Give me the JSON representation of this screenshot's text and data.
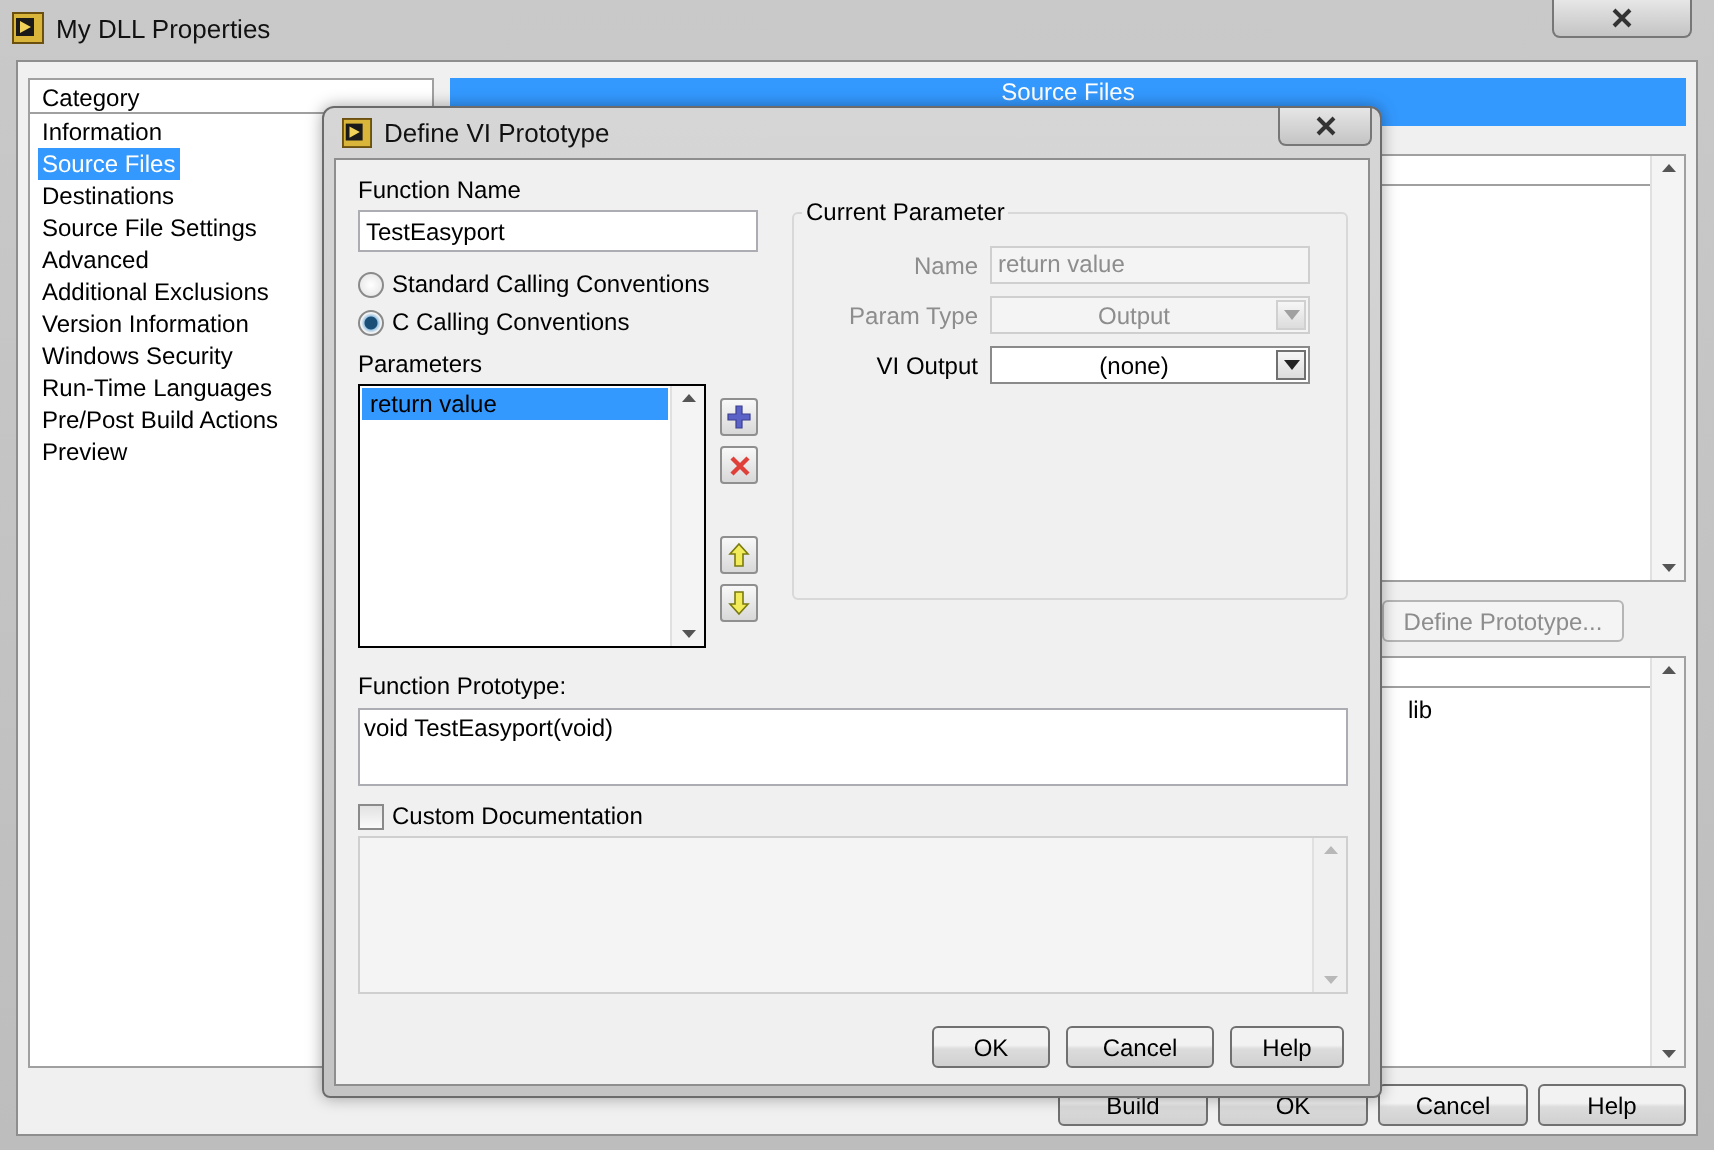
{
  "window": {
    "title": "My DLL Properties"
  },
  "category": {
    "header": "Category",
    "items": [
      {
        "label": "Information",
        "selected": false
      },
      {
        "label": "Source Files",
        "selected": true
      },
      {
        "label": "Destinations",
        "selected": false
      },
      {
        "label": "Source File Settings",
        "selected": false
      },
      {
        "label": "Advanced",
        "selected": false
      },
      {
        "label": "Additional Exclusions",
        "selected": false
      },
      {
        "label": "Version Information",
        "selected": false
      },
      {
        "label": "Windows Security",
        "selected": false
      },
      {
        "label": "Run-Time Languages",
        "selected": false
      },
      {
        "label": "Pre/Post Build Actions",
        "selected": false
      },
      {
        "label": "Preview",
        "selected": false
      }
    ]
  },
  "page_header": "Source Files",
  "define_prototype_button": {
    "label": "Define Prototype...",
    "disabled": true
  },
  "exported_list": {
    "item": "lib"
  },
  "buttons": [
    "Build",
    "OK",
    "Cancel",
    "Help"
  ],
  "dialog": {
    "title": "Define VI Prototype",
    "function_name_label": "Function Name",
    "function_name": "TestEasyport",
    "conventions": [
      {
        "label": "Standard Calling Conventions",
        "selected": false
      },
      {
        "label": "C Calling Conventions",
        "selected": true
      }
    ],
    "parameters_label": "Parameters",
    "parameters": [
      {
        "label": "return value",
        "selected": true
      }
    ],
    "current_parameter": {
      "title": "Current Parameter",
      "fields": [
        {
          "label": "Name",
          "value": "return value",
          "kind": "text",
          "disabled": true
        },
        {
          "label": "Param Type",
          "value": "Output",
          "kind": "dropdown",
          "disabled": true
        },
        {
          "label": "VI Output",
          "value": "(none)",
          "kind": "dropdown",
          "disabled": false
        }
      ]
    },
    "prototype_label": "Function Prototype:",
    "prototype": "void TestEasyport(void)",
    "custom_doc": {
      "label": "Custom Documentation",
      "checked": false
    },
    "buttons": [
      "OK",
      "Cancel",
      "Help"
    ]
  }
}
